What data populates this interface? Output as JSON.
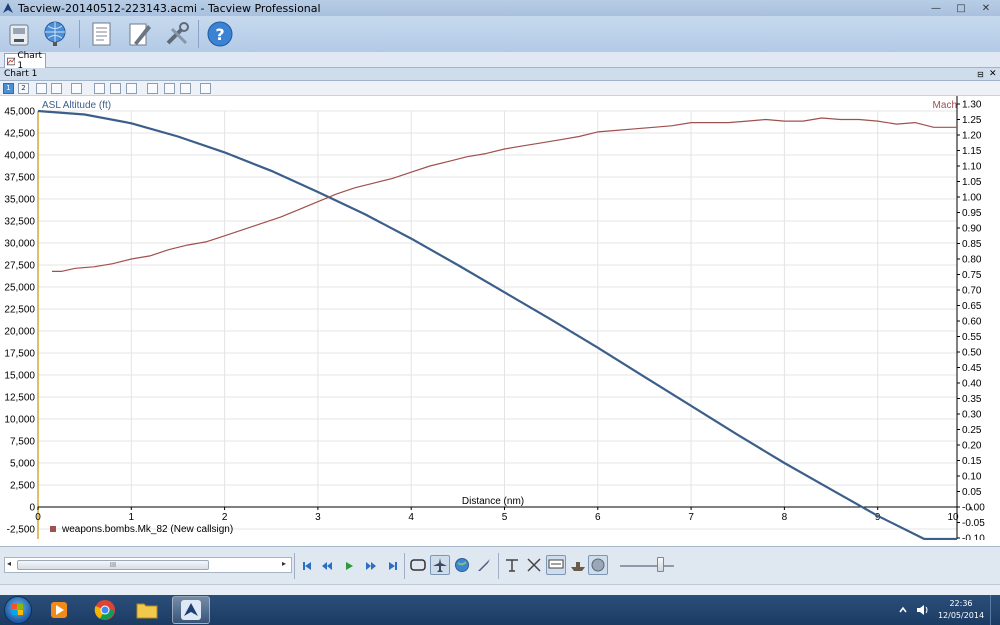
{
  "window": {
    "title": "Tacview-20140512-223143.acmi - Tacview Professional",
    "minimize_glyph": "—",
    "maximize_glyph": "□",
    "close_glyph": "✕"
  },
  "main_toolbar": {
    "icons": [
      "open-file-icon",
      "globe-network-icon",
      "document-list-icon",
      "edit-notes-icon",
      "tools-icon",
      "help-icon"
    ]
  },
  "doc_tab": {
    "label": "Chart 1"
  },
  "panel": {
    "title": "Chart 1",
    "pin_glyph": "⊟",
    "close_glyph": "✕"
  },
  "chart_toolbar": {
    "button_1": "1",
    "button_2": "2"
  },
  "chart_data": {
    "type": "line",
    "xlabel": "Distance (nm)",
    "x_ticks": [
      "0",
      "1",
      "2",
      "3",
      "4",
      "5",
      "6",
      "7",
      "8",
      "9",
      "10"
    ],
    "xlim": [
      0,
      9.85
    ],
    "y_left": {
      "label": "ASL Altitude (ft)",
      "ticks": [
        "45,000",
        "42,500",
        "40,000",
        "37,500",
        "35,000",
        "32,500",
        "30,000",
        "27,500",
        "25,000",
        "22,500",
        "20,000",
        "17,500",
        "15,000",
        "12,500",
        "10,000",
        "7,500",
        "5,000",
        "2,500",
        "0",
        "-2,500"
      ],
      "lim": [
        -2500,
        45000
      ]
    },
    "y_right": {
      "label": "Mach",
      "ticks": [
        "1.30",
        "1.25",
        "1.20",
        "1.15",
        "1.10",
        "1.05",
        "1.00",
        "0.95",
        "0.90",
        "0.85",
        "0.80",
        "0.75",
        "0.70",
        "0.65",
        "0.60",
        "0.55",
        "0.50",
        "0.45",
        "0.40",
        "0.35",
        "0.30",
        "0.25",
        "0.20",
        "0.15",
        "0.10",
        "0.05",
        "-0.00",
        "-0.05",
        "-0.10"
      ],
      "lim": [
        -0.05,
        1.3
      ]
    },
    "grid": true,
    "series": [
      {
        "name": "ASL Altitude (ft)",
        "axis": "left",
        "color": "#3b5f8a",
        "x": [
          0,
          0.5,
          1,
          1.5,
          2,
          2.5,
          3,
          3.5,
          4,
          4.5,
          5,
          5.5,
          6,
          6.5,
          7,
          7.5,
          8,
          8.5,
          9,
          9.5,
          9.85
        ],
        "y": [
          45000,
          44600,
          43600,
          42100,
          40300,
          38200,
          35800,
          33300,
          30500,
          27500,
          24400,
          21300,
          18100,
          14800,
          11500,
          8200,
          5000,
          2000,
          -1000,
          -4300,
          -6500
        ]
      },
      {
        "name": "Mach",
        "axis": "right",
        "color": "#a0504e",
        "x": [
          0.15,
          0.25,
          0.4,
          0.6,
          0.8,
          1.0,
          1.2,
          1.4,
          1.6,
          1.8,
          2.0,
          2.2,
          2.4,
          2.6,
          2.8,
          3.0,
          3.2,
          3.4,
          3.6,
          3.8,
          4.0,
          4.2,
          4.4,
          4.6,
          4.8,
          5.0,
          5.2,
          5.4,
          5.6,
          5.8,
          6.0,
          6.2,
          6.4,
          6.6,
          6.8,
          7.0,
          7.2,
          7.4,
          7.6,
          7.8,
          8.0,
          8.2,
          8.4,
          8.6,
          8.8,
          9.0,
          9.2,
          9.4,
          9.6,
          9.85
        ],
        "y": [
          0.76,
          0.76,
          0.77,
          0.775,
          0.785,
          0.8,
          0.81,
          0.83,
          0.845,
          0.855,
          0.875,
          0.895,
          0.915,
          0.935,
          0.96,
          0.985,
          1.01,
          1.03,
          1.045,
          1.06,
          1.08,
          1.1,
          1.115,
          1.13,
          1.14,
          1.155,
          1.165,
          1.175,
          1.185,
          1.195,
          1.21,
          1.215,
          1.22,
          1.225,
          1.23,
          1.24,
          1.24,
          1.24,
          1.245,
          1.25,
          1.245,
          1.245,
          1.255,
          1.25,
          1.25,
          1.245,
          1.235,
          1.24,
          1.225,
          1.225
        ]
      }
    ],
    "legend": {
      "label": "weapons.bombs.Mk_82 (New callsign)",
      "color": "#a0504e",
      "placement": "bottom-left"
    }
  },
  "playbar": {
    "controls": [
      "skip-start-icon",
      "rewind-icon",
      "play-icon",
      "fast-forward-icon",
      "skip-end-icon"
    ],
    "scroll_thumb": "III"
  },
  "taskbar": {
    "clock_time": "22:36",
    "clock_date": "12/05/2014"
  }
}
